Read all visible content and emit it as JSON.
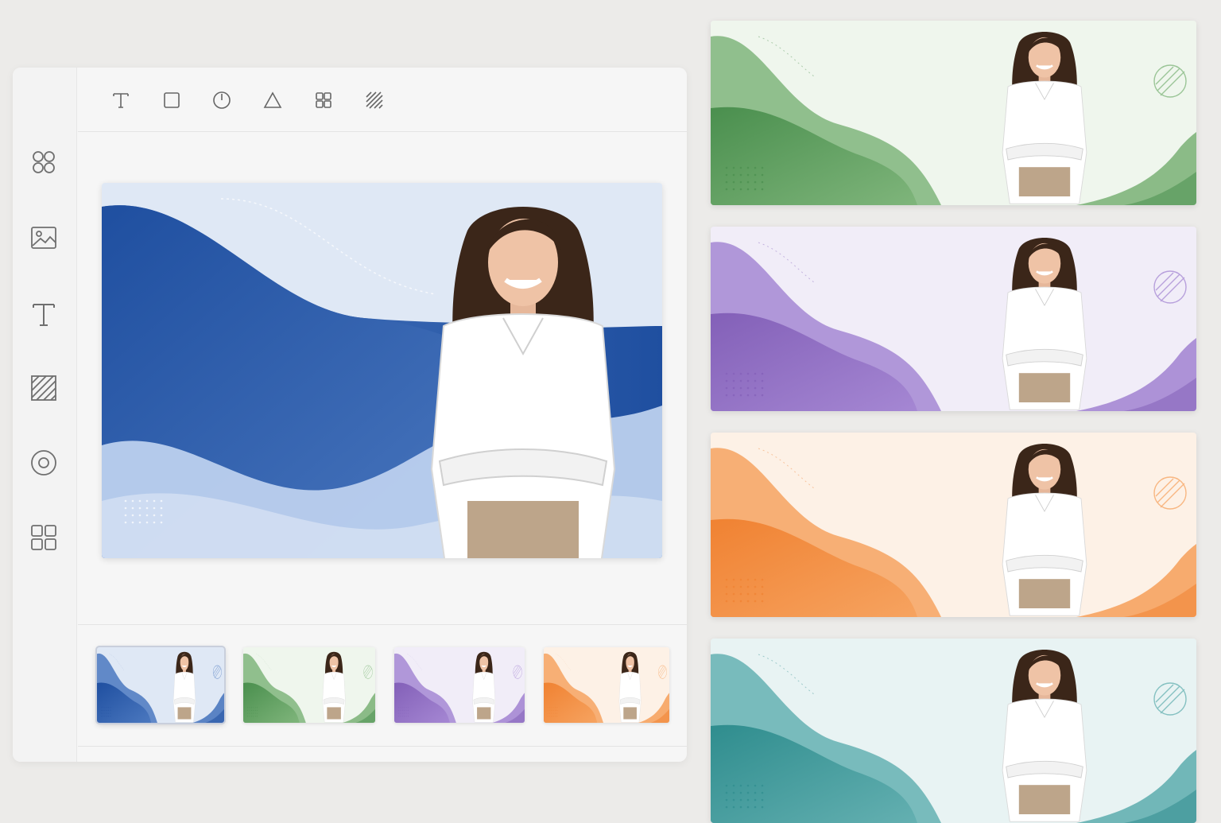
{
  "toolbar": {
    "tools": [
      {
        "name": "text-tool",
        "icon": "text-icon"
      },
      {
        "name": "rectangle-tool",
        "icon": "square-icon"
      },
      {
        "name": "timer-tool",
        "icon": "clock-icon"
      },
      {
        "name": "triangle-tool",
        "icon": "triangle-icon"
      },
      {
        "name": "grid-tool",
        "icon": "grid-icon"
      },
      {
        "name": "pattern-tool",
        "icon": "hatch-pattern-icon"
      }
    ]
  },
  "sidebar": {
    "items": [
      {
        "name": "templates",
        "icon": "four-circles-icon"
      },
      {
        "name": "images",
        "icon": "image-icon"
      },
      {
        "name": "text",
        "icon": "text-icon"
      },
      {
        "name": "patterns",
        "icon": "hatch-pattern-icon"
      },
      {
        "name": "elements",
        "icon": "target-circle-icon"
      },
      {
        "name": "layouts",
        "icon": "grid-layout-icon"
      }
    ]
  },
  "themes": {
    "blue": {
      "bg": "#dfe8f5",
      "dark": "#1f4fa0",
      "mid": "#4b78bf",
      "light": "#bcd0ee"
    },
    "green": {
      "bg": "#eff6ed",
      "dark": "#4a8f4e",
      "mid": "#7fb57b",
      "light": "#b6d8b0"
    },
    "purple": {
      "bg": "#f1edf8",
      "dark": "#8360b8",
      "mid": "#a587d3",
      "light": "#d1c1ec"
    },
    "orange": {
      "bg": "#fdf1e6",
      "dark": "#f08232",
      "mid": "#f6a360",
      "light": "#fad1aa"
    },
    "teal": {
      "bg": "#e8f3f3",
      "dark": "#2f8d8e",
      "mid": "#64b0b1",
      "light": "#a9d3d4"
    }
  },
  "canvas": {
    "active_theme": "blue"
  },
  "filmstrip": {
    "thumbnails": [
      "blue",
      "green",
      "purple",
      "orange"
    ],
    "selected_index": 0
  },
  "variants": [
    "green",
    "purple",
    "orange",
    "teal"
  ]
}
